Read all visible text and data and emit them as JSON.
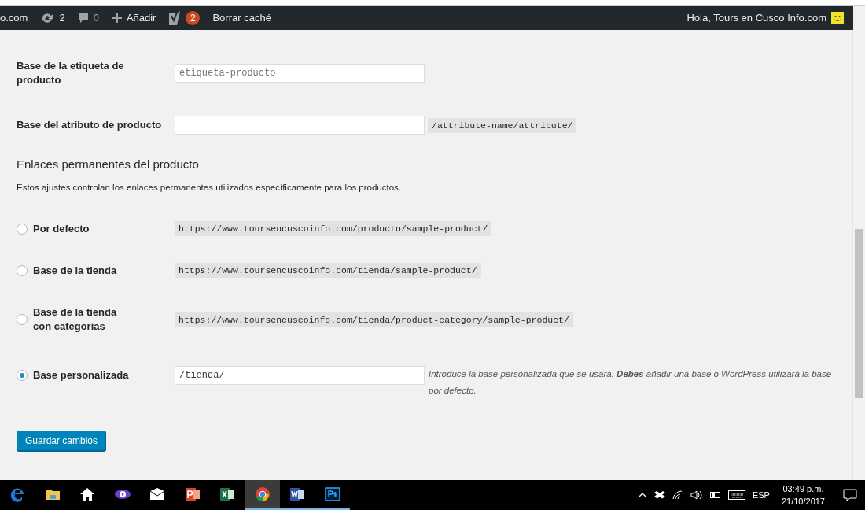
{
  "admin_bar": {
    "site": "o.com",
    "updates": "2",
    "comments": "0",
    "add": "Añadir",
    "seo_count": "2",
    "clear_cache": "Borrar caché",
    "greeting": "Hola, Tours en Cusco Info.com"
  },
  "fields": [
    {
      "label": "Base de la etiqueta de producto",
      "placeholder": "etiqueta-producto"
    },
    {
      "label": "Base del atributo de producto",
      "hint": "/attribute-name/attribute/"
    }
  ],
  "section": {
    "title": "Enlaces permanentes del producto",
    "description": "Estos ajustes controlan los enlaces permanentes utilizados específicamente para los productos."
  },
  "permalink_options": [
    {
      "kind": "example",
      "label": "Por defecto",
      "selected": false,
      "example": "https://www.toursencuscoinfo.com/producto/sample-product/"
    },
    {
      "kind": "example",
      "label": "Base de la tienda",
      "selected": false,
      "example": "https://www.toursencuscoinfo.com/tienda/sample-product/"
    },
    {
      "kind": "example",
      "label": "Base de la tienda con categorias",
      "selected": false,
      "example": "https://www.toursencuscoinfo.com/tienda/product-category/sample-product/"
    },
    {
      "kind": "custom",
      "label": "Base personalizada",
      "selected": true,
      "value": "/tienda/",
      "description": "Introduce la base personalizada que se usará. **Debes** añadir una base o WordPress utilizará la base por defecto."
    }
  ],
  "save_button": "Guardar cambios",
  "taskbar": {
    "apps": [
      {
        "kind": "edge",
        "selected": false,
        "open": false
      },
      {
        "kind": "folder",
        "selected": false,
        "open": false
      },
      {
        "kind": "home",
        "selected": false,
        "open": false
      },
      {
        "kind": "eye",
        "selected": false,
        "open": false
      },
      {
        "kind": "mail",
        "selected": false,
        "open": false
      },
      {
        "kind": "powerpoint",
        "selected": false,
        "open": false
      },
      {
        "kind": "excel",
        "selected": false,
        "open": false
      },
      {
        "kind": "chrome",
        "selected": true,
        "open": true
      },
      {
        "kind": "word",
        "selected": false,
        "open": true
      },
      {
        "kind": "photoshop",
        "selected": false,
        "open": true
      }
    ],
    "language": "ESP",
    "time": "03:49 p.m.",
    "date": "21/10/2017"
  }
}
